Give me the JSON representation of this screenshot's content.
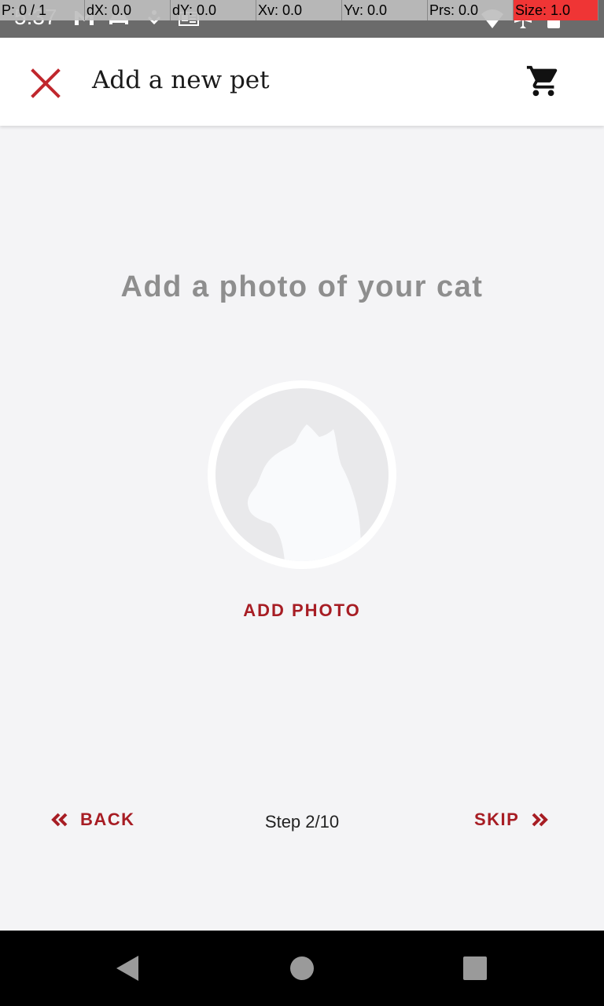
{
  "status_bar": {
    "time": "5:37",
    "icons": [
      "gmail-icon",
      "car-icon",
      "download-icon",
      "news-icon",
      "wifi-icon",
      "airplane-icon",
      "battery-icon"
    ]
  },
  "debug_overlay": {
    "pointer": "P: 0 / 1",
    "dx": "dX: 0.0",
    "dy": "dY: 0.0",
    "xv": "Xv: 0.0",
    "yv": "Yv: 0.0",
    "prs": "Prs: 0.0",
    "size": "Size: 1.0"
  },
  "toolbar": {
    "close_icon": "close-icon",
    "title": "Add a new pet",
    "cart_icon": "shopping-cart-icon"
  },
  "content": {
    "heading": "Add a photo of your cat",
    "placeholder_icon": "cat-silhouette-icon",
    "add_photo_label": "ADD PHOTO"
  },
  "footer": {
    "back_label": "BACK",
    "step_text": "Step 2/10",
    "skip_label": "SKIP"
  },
  "system_nav": {
    "icons": [
      "back-triangle-icon",
      "home-circle-icon",
      "recents-square-icon"
    ]
  },
  "colors": {
    "accent": "#a71d24",
    "background": "#f4f4f6",
    "heading": "#8e8e8e"
  }
}
